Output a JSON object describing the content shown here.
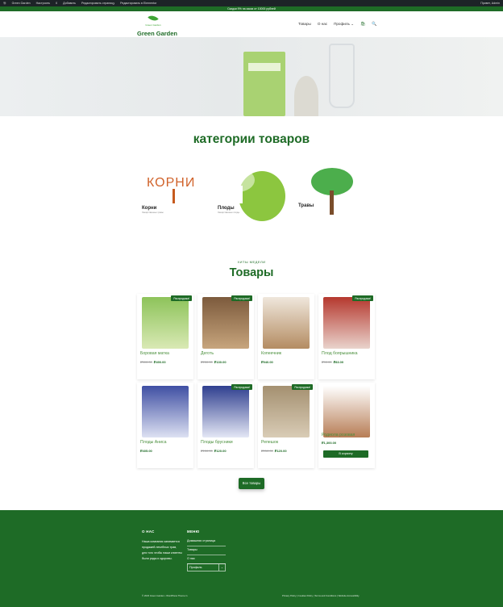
{
  "admin_bar": {
    "site": "Green Garden",
    "customize": "Настроить",
    "comments": "0",
    "add": "Добавить",
    "edit_page": "Редактировать страницу",
    "edit_elementor": "Редактировать в Elementor",
    "greeting": "Привет, Admin"
  },
  "promo": "Скидки 9% на заказ от 10000 рублей",
  "header": {
    "logo_small": "Green Garden",
    "site_name": "Green Garden",
    "nav": [
      "Товары",
      "О нас",
      "Профиль"
    ],
    "nav_dropdown": "⌄",
    "cart_icon": "cart-icon",
    "search_icon": "search-icon"
  },
  "categories": {
    "title": "категории товаров",
    "items": [
      {
        "image_text": "КОРНИ",
        "name": "Корни",
        "desc": "Лекарственные травы"
      },
      {
        "name": "Плоды",
        "desc": "Лекарственные плоды"
      },
      {
        "name": "Травы",
        "desc": ""
      }
    ]
  },
  "products": {
    "subtitle": "ХИТЫ МЕДЕЛИ",
    "title": "Товары",
    "badge": "Распродажа!",
    "items": [
      {
        "name": "Боровая матка",
        "old": "₽500.00",
        "price": "₽490.00",
        "sale": true
      },
      {
        "name": "Деготь",
        "old": "₽230.00",
        "price": "₽130.00",
        "sale": true
      },
      {
        "name": "Копеечник",
        "old": "",
        "price": "₽940.00",
        "sale": false
      },
      {
        "name": "Плод боярышника",
        "old": "₽90.00",
        "price": "₽83.00",
        "sale": true
      },
      {
        "name": "Плоды Аниса",
        "old": "",
        "price": "₽405.00",
        "sale": false
      },
      {
        "name": "Плоды брусники",
        "old": "₽130.00",
        "price": "₽120.00",
        "sale": true
      },
      {
        "name": "Репешок",
        "old": "₽250.00",
        "price": "₽120.00",
        "sale": true
      },
      {
        "name": "Родиола розовая",
        "old": "",
        "price": "₽1,300.00",
        "sale": false,
        "button": "В корзину"
      }
    ],
    "all_button": "Все товары"
  },
  "footer": {
    "about_title": "О НАС",
    "about_text": "Наша компания занимается продажей лечебных трав, для того чтобы наши клиенты были рады и здоровы.",
    "menu_title": "МЕНЮ",
    "menu_items": [
      "Домашняя страница",
      "Товары",
      "О нас"
    ],
    "menu_select": "Профиль",
    "menu_select_arrow": "⌄",
    "copyright": "© 2023 Green Garden • WordPress Theme in",
    "links": "Privacy Policy | Cookies Policy | Terms and Conditions | Website Accessibility"
  },
  "colors": {
    "brand": "#1e6b26",
    "accent": "#3fa535"
  }
}
